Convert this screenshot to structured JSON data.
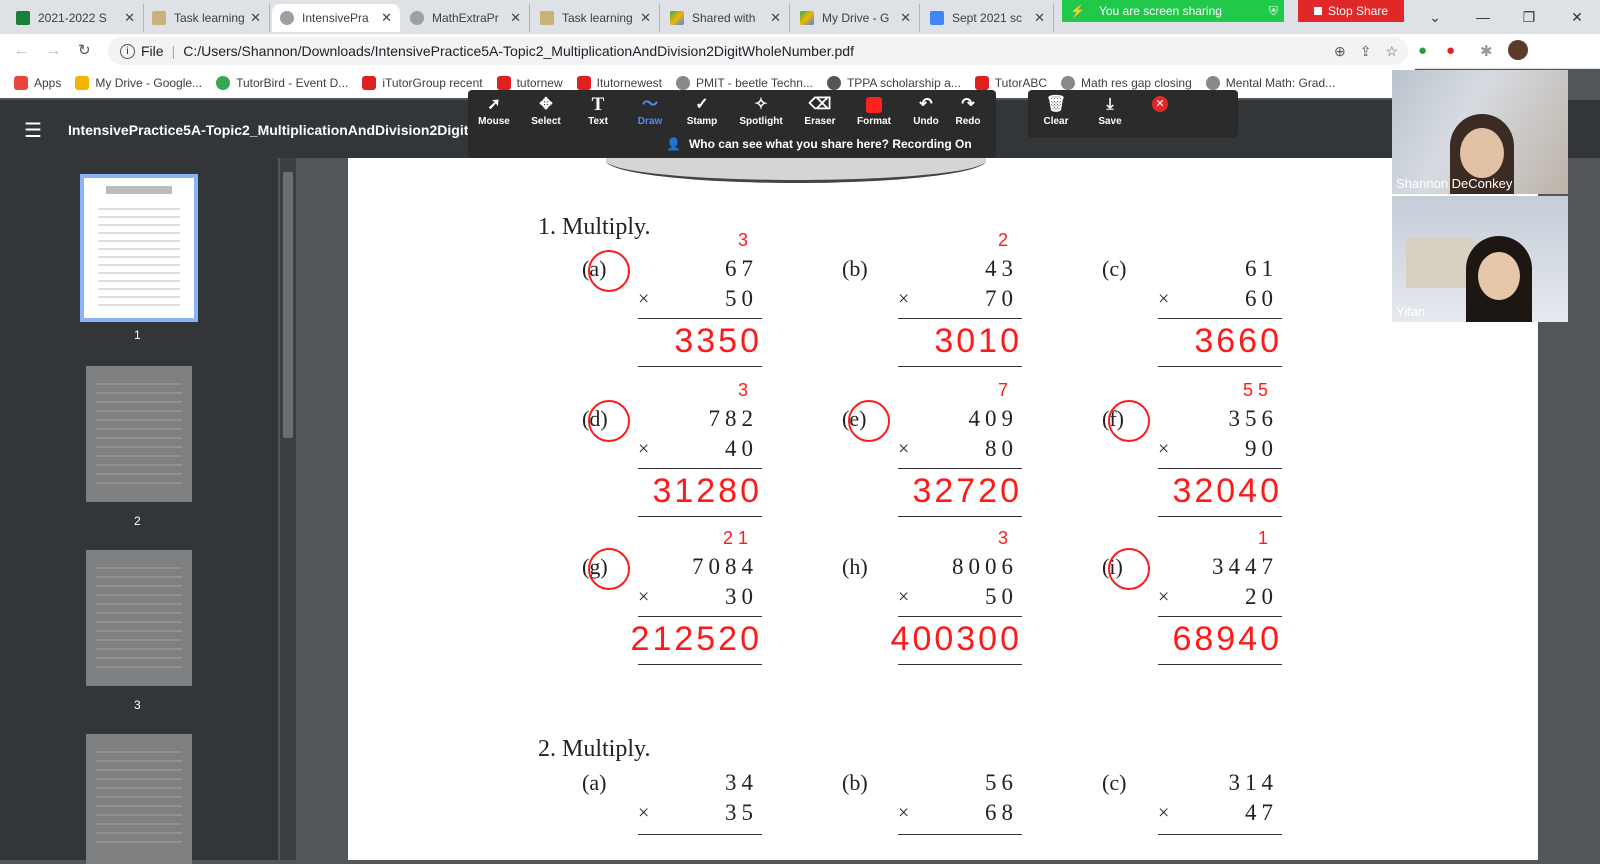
{
  "tabs": [
    {
      "label": "2021-2022 S",
      "color": "#188038"
    },
    {
      "label": "Task learning",
      "color": "#8a7b4c"
    },
    {
      "label": "IntensivePra",
      "color": "#5f6368"
    },
    {
      "label": "MathExtraPr",
      "color": "#5f6368"
    },
    {
      "label": "Task learning",
      "color": "#8a7b4c"
    },
    {
      "label": "Shared with",
      "color": "#f4b400"
    },
    {
      "label": "My Drive - G",
      "color": "#f4b400"
    },
    {
      "label": "Sept 2021 sc",
      "color": "#4285f4"
    }
  ],
  "share": {
    "banner": "You are screen sharing",
    "stop": "Stop Share"
  },
  "address": {
    "scheme": "File",
    "url": "C:/Users/Shannon/Downloads/IntensivePractice5A-Topic2_MultiplicationAndDivision2DigitWholeNumber.pdf"
  },
  "bookmarks": [
    {
      "label": "Apps",
      "color": "#e8453c"
    },
    {
      "label": "My Drive - Google...",
      "color": "#f4b400"
    },
    {
      "label": "TutorBird - Event D...",
      "color": "#34a853"
    },
    {
      "label": "iTutorGroup recent",
      "color": "#e02020"
    },
    {
      "label": "tutornew",
      "color": "#e02020"
    },
    {
      "label": "Itutornewest",
      "color": "#e02020"
    },
    {
      "label": "PMIT - beetle Techn...",
      "color": "#888888"
    },
    {
      "label": "TPPA scholarship a...",
      "color": "#555555"
    },
    {
      "label": "TutorABC",
      "color": "#e02020"
    },
    {
      "label": "Math res gap closing",
      "color": "#888888"
    },
    {
      "label": "Mental Math: Grad...",
      "color": "#888888"
    }
  ],
  "pdf": {
    "title": "IntensivePractice5A-Topic2_MultiplicationAndDivision2DigitWholeNumber.pdf"
  },
  "thumbs": [
    "1",
    "2",
    "3"
  ],
  "annotate": {
    "tools": [
      "Mouse",
      "Select",
      "Text",
      "Draw",
      "Stamp",
      "Spotlight",
      "Eraser",
      "Format",
      "Undo",
      "Redo",
      "Clear",
      "Save"
    ],
    "active": "Draw",
    "notice": "Who can see what you share here? Recording On"
  },
  "participants": [
    {
      "name": "Shannon DeConkey"
    },
    {
      "name": "Yifan"
    }
  ],
  "worksheet": {
    "q1_title": "1.  Multiply.",
    "q2_title": "2.  Multiply.",
    "times": "×",
    "q1": [
      {
        "label": "(a)",
        "top": "67",
        "bottom": "50",
        "answer": "3350",
        "carry": "3"
      },
      {
        "label": "(b)",
        "top": "43",
        "bottom": "70",
        "answer": "3010",
        "carry": "2"
      },
      {
        "label": "(c)",
        "top": "61",
        "bottom": "60",
        "answer": "3660",
        "carry": ""
      },
      {
        "label": "(d)",
        "top": "782",
        "bottom": "40",
        "answer": "31280",
        "carry": "3"
      },
      {
        "label": "(e)",
        "top": "409",
        "bottom": "80",
        "answer": "32720",
        "carry": "7"
      },
      {
        "label": "(f)",
        "top": "356",
        "bottom": "90",
        "answer": "32040",
        "carry": "5 5"
      },
      {
        "label": "(g)",
        "top": "7084",
        "bottom": "30",
        "answer": "212520",
        "carry": "2 1"
      },
      {
        "label": "(h)",
        "top": "8006",
        "bottom": "50",
        "answer": "400300",
        "carry": "3"
      },
      {
        "label": "(i)",
        "top": "3447",
        "bottom": "20",
        "answer": "68940",
        "carry": "1"
      }
    ],
    "q2": [
      {
        "label": "(a)",
        "top": "34",
        "bottom": "35"
      },
      {
        "label": "(b)",
        "top": "56",
        "bottom": "68"
      },
      {
        "label": "(c)",
        "top": "314",
        "bottom": "47"
      }
    ]
  }
}
